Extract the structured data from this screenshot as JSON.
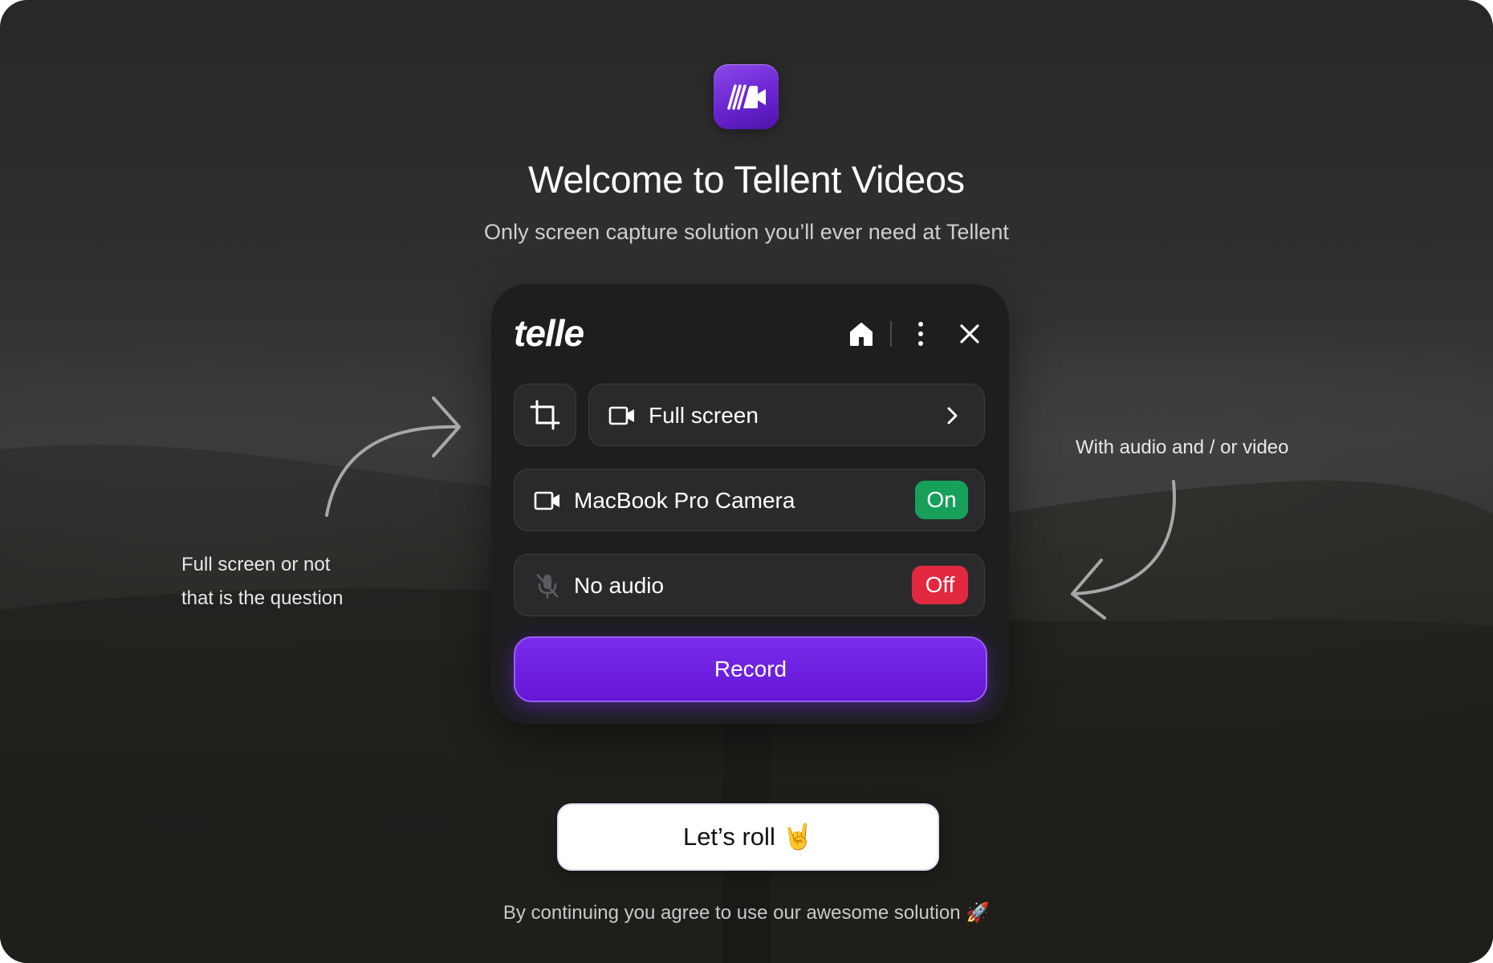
{
  "app": {
    "title": "Welcome to Tellent Videos",
    "subtitle": "Only screen capture solution you’ll ever need at Tellent",
    "logo_icon": "video-camera-icon",
    "accent_color": "#6a1fd6"
  },
  "widget": {
    "brand": "telle",
    "header_icons": [
      "home-icon",
      "more-vertical-icon",
      "close-icon"
    ],
    "source": {
      "crop_icon": "crop-icon",
      "label": "Full screen",
      "icon": "video-camera-icon",
      "chevron_icon": "chevron-right-icon"
    },
    "camera": {
      "label": "MacBook Pro Camera",
      "icon": "video-camera-icon",
      "toggle_label": "On",
      "toggle_color": "#17a05a"
    },
    "audio": {
      "label": "No audio",
      "icon": "microphone-off-icon",
      "toggle_label": "Off",
      "toggle_color": "#e1283f"
    },
    "record_label": "Record"
  },
  "annotations": {
    "left_line1": "Full screen or not",
    "left_line2": "that is the question",
    "right": "With audio and / or video"
  },
  "cta": {
    "label": "Let’s roll 🤘"
  },
  "footer": {
    "text": "By continuing you agree to use our awesome solution 🚀"
  }
}
